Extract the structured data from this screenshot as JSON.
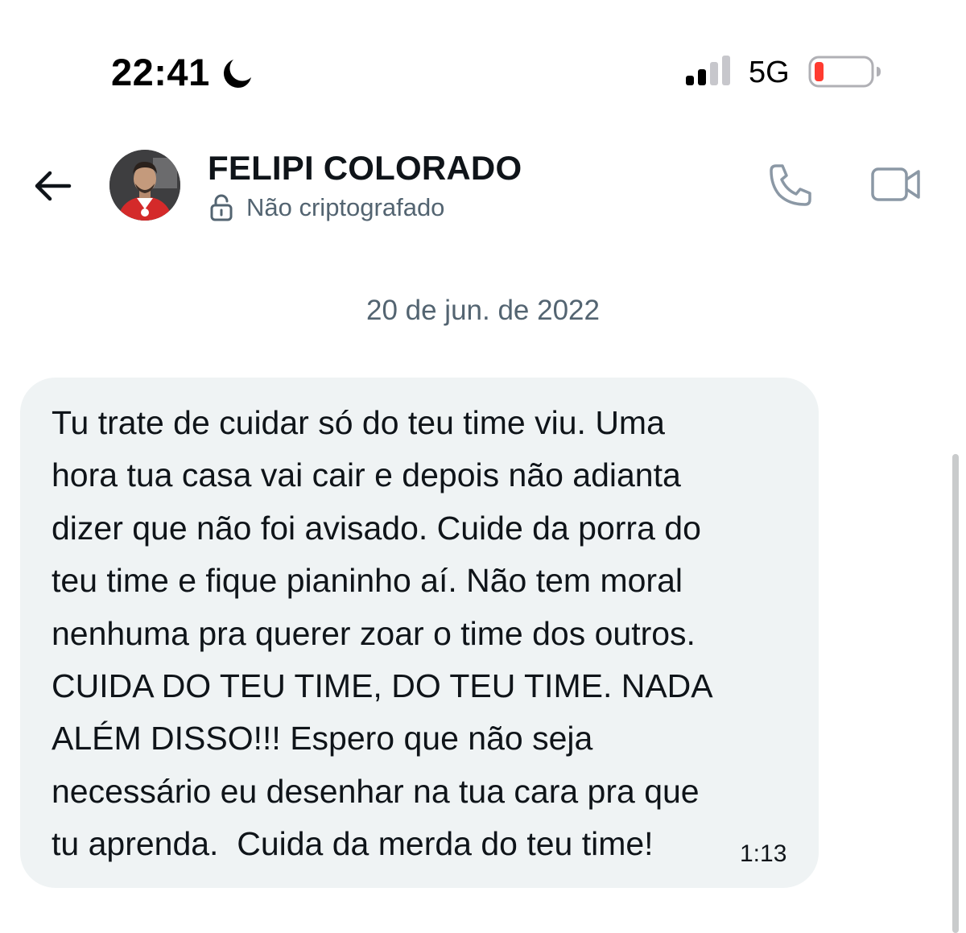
{
  "status_bar": {
    "time": "22:41",
    "moon_icon": "moon-icon",
    "signal_icon": "cellular-signal-icon",
    "network": "5G",
    "battery_icon": "battery-low-icon",
    "battery_color": "#ff3b30"
  },
  "header": {
    "back_icon": "arrow-left-icon",
    "contact_name": "FELIPI COLORADO",
    "encryption_label": "Não criptografado",
    "lock_icon": "unlock-icon",
    "call_icon": "phone-icon",
    "video_icon": "video-camera-icon"
  },
  "conversation": {
    "date_separator": "20 de jun. de 2022",
    "messages": [
      {
        "text": "Tu trate de cuidar só do teu time viu. Uma\nhora tua casa vai cair e depois não adianta\ndizer que não foi avisado. Cuide da porra do\nteu time e fique pianinho aí. Não tem moral\nnenhuma pra querer zoar o time dos outros.\nCUIDA DO TEU TIME, DO TEU TIME. NADA\nALÉM DISSO!!! Espero que não seja\nnecessário eu desenhar na tua cara pra que\ntu aprenda.  Cuida da merda do teu time!",
        "time": "1:13",
        "bubble_color": "#eff3f4"
      }
    ]
  },
  "colors": {
    "primary_text": "#0f1419",
    "secondary_text": "#536471",
    "icon_gray": "#8b98a5"
  }
}
